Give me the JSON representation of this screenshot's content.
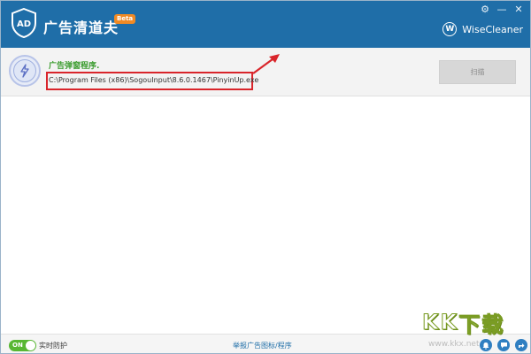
{
  "app": {
    "title": "广告清道夫",
    "badge": "Beta",
    "logo_text": "AD"
  },
  "window_controls": {
    "settings_icon": "gear-icon",
    "minimize_icon": "minus-icon",
    "close_icon": "close-icon",
    "minimize_symbol": "—",
    "close_symbol": "✕",
    "settings_symbol": "⚙"
  },
  "brand": {
    "mark": "W",
    "name": "WiseCleaner"
  },
  "detection": {
    "label": "广告弹窗程序.",
    "path": "C:\\Program Files (x86)\\SogouInput\\8.6.0.1467\\PinyinUp.exe",
    "scan_label": "扫描"
  },
  "statusbar": {
    "toggle_label": "ON",
    "realtime_label": "实时防护",
    "report_link": "举报广告图标/程序"
  },
  "watermark": {
    "chars": [
      "K",
      "K",
      "下",
      "载"
    ],
    "url": "www.kkx.net"
  },
  "colors": {
    "titlebar": "#1f6ea8",
    "highlight": "#d9252b",
    "toggle_on": "#58b733",
    "label_green": "#3a9c2e"
  }
}
